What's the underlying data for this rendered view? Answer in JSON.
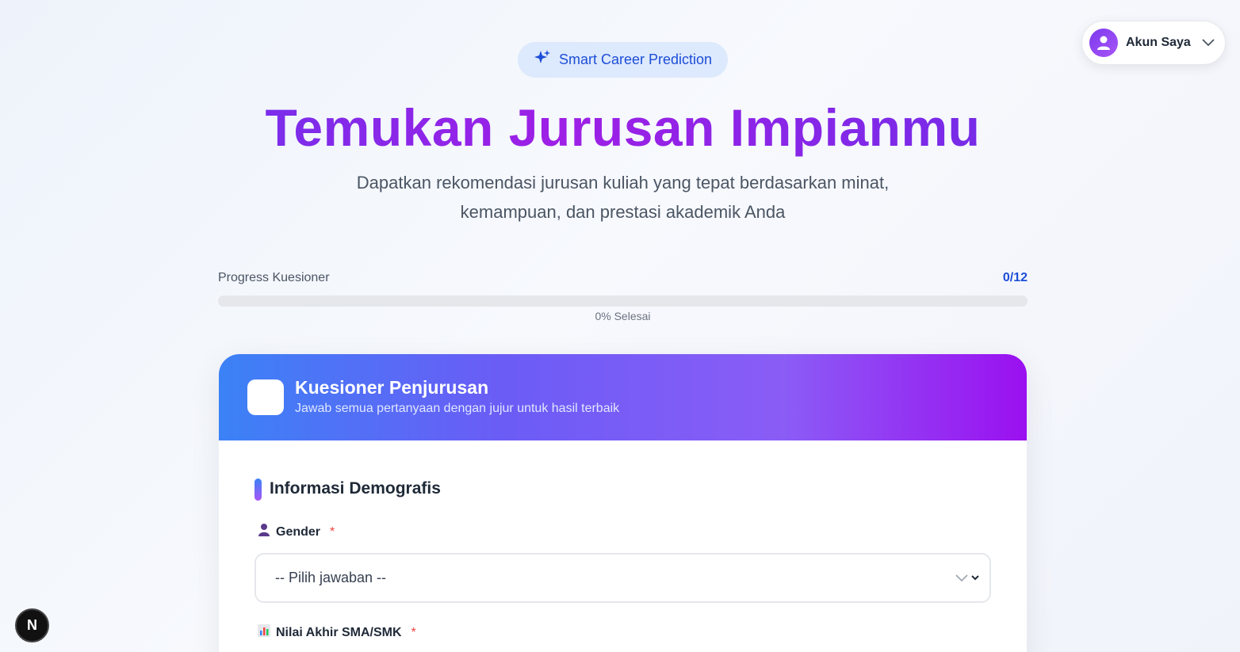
{
  "account": {
    "label": "Akun Saya",
    "icon": "user-avatar-icon"
  },
  "badge": {
    "label": "Smart Career Prediction",
    "icon": "sparkles-icon"
  },
  "hero": {
    "title": "Temukan Jurusan Impianmu",
    "subtitle_line1": "Dapatkan rekomendasi jurusan kuliah yang tepat berdasarkan minat,",
    "subtitle_line2": "kemampuan, dan prestasi akademik Anda"
  },
  "progress": {
    "label": "Progress Kuesioner",
    "count": "0/12",
    "percent_text": "0% Selesai",
    "fraction": 0
  },
  "card": {
    "title": "Kuesioner Penjurusan",
    "subtitle": "Jawab semua pertanyaan dengan jujur untuk hasil terbaik"
  },
  "section": {
    "title": "Informasi Demografis"
  },
  "fields": {
    "gender": {
      "label": "Gender",
      "icon": "person-icon",
      "required": "*",
      "value": "-- Pilih jawaban --"
    },
    "grade": {
      "label": "Nilai Akhir SMA/SMK",
      "icon": "bar-chart-icon",
      "required": "*"
    }
  },
  "devtools": {
    "label": "N"
  },
  "colors": {
    "accent_blue": "#1d4ed8",
    "accent_purple": "#9b10f0",
    "required_red": "#ef4444"
  }
}
